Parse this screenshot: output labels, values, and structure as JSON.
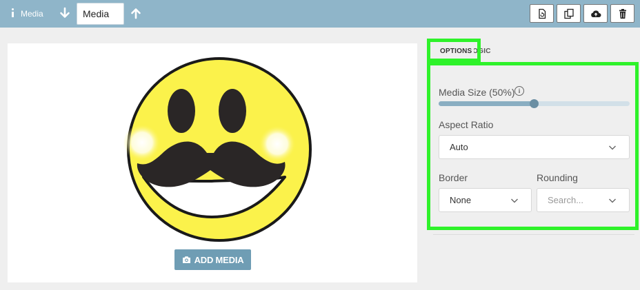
{
  "toolbar": {
    "title": "Media",
    "name_value": "Media",
    "buttons": [
      "refresh-icon",
      "copy-icon",
      "cloud-upload-icon",
      "trash-icon"
    ]
  },
  "canvas": {
    "add_media_label": "ADD MEDIA"
  },
  "tabs": {
    "options": "OPTIONS",
    "logic": "LOGIC"
  },
  "settings": {
    "media_size_label": "Media Size (50%)",
    "media_size_value": 0.5,
    "aspect_ratio_label": "Aspect Ratio",
    "aspect_ratio_value": "Auto",
    "border_label": "Border",
    "border_value": "None",
    "rounding_label": "Rounding",
    "rounding_placeholder": "Search..."
  },
  "colors": {
    "topbar": "#8fb5c9",
    "accent": "#6f9db4",
    "highlight": "#2ef22a"
  }
}
